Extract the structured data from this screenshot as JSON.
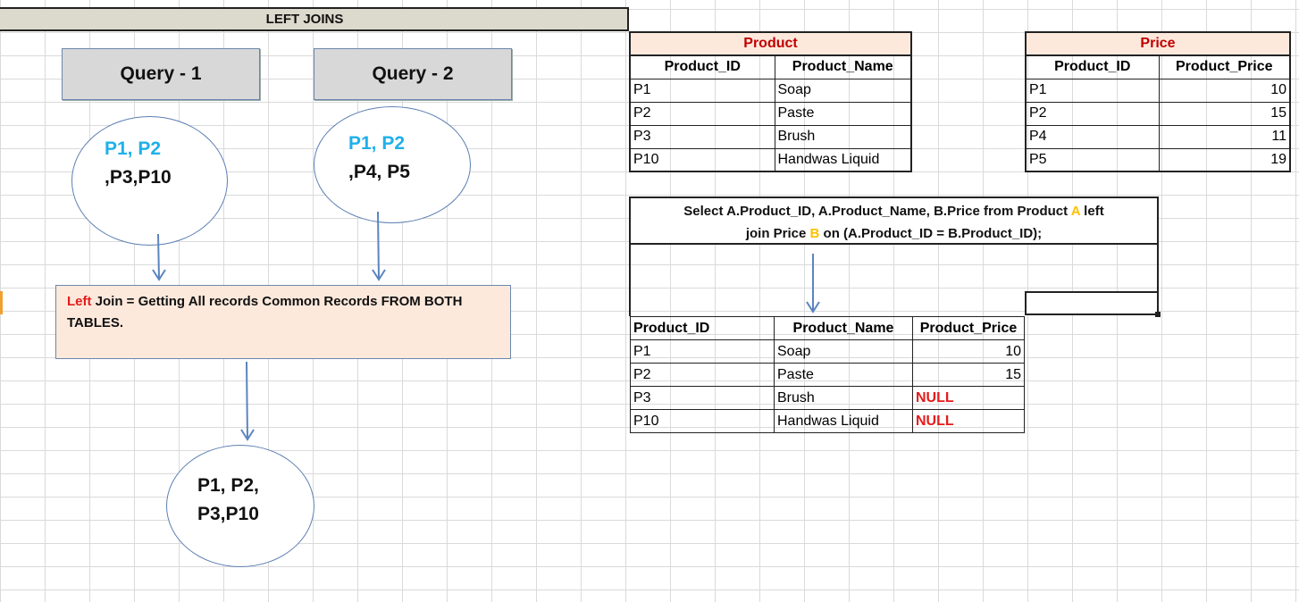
{
  "title": "LEFT JOINS",
  "queries": {
    "q1_label": "Query - 1",
    "q2_label": "Query - 2"
  },
  "ellipses": {
    "q1_line1": "P1, P2",
    "q1_line2": ",P3,P10",
    "q2_line1": "P1, P2",
    "q2_line2": ",P4, P5",
    "result_line1": "P1, P2,",
    "result_line2": "P3,P10"
  },
  "description": {
    "keyword": "Left",
    "text": " Join = Getting All records Common Records FROM BOTH TABLES."
  },
  "product_table": {
    "caption": "Product",
    "headers": [
      "Product_ID",
      "Product_Name"
    ],
    "rows": [
      [
        "P1",
        "Soap"
      ],
      [
        "P2",
        "Paste"
      ],
      [
        "P3",
        "Brush"
      ],
      [
        "P10",
        "Handwas Liquid"
      ]
    ]
  },
  "price_table": {
    "caption": "Price",
    "headers": [
      "Product_ID",
      "Product_Price"
    ],
    "rows": [
      [
        "P1",
        "10"
      ],
      [
        "P2",
        "15"
      ],
      [
        "P4",
        "11"
      ],
      [
        "P5",
        "19"
      ]
    ]
  },
  "sql": {
    "part1": "Select A.Product_ID, A.Product_Name, B.Price from Product ",
    "alias_a": "A",
    "part2": " left",
    "part3": "join Price ",
    "alias_b": "B",
    "part4": " on (A.Product_ID = B.Product_ID);"
  },
  "result_table": {
    "headers": [
      "Product_ID",
      "Product_Name",
      "Product_Price"
    ],
    "rows": [
      [
        "P1",
        "Soap",
        "10"
      ],
      [
        "P2",
        "Paste",
        "15"
      ],
      [
        "P3",
        "Brush",
        "NULL"
      ],
      [
        "P10",
        "Handwas Liquid",
        "NULL"
      ]
    ]
  },
  "colors": {
    "accent_cyan": "#1fb0ea",
    "null_red": "#e51b1b",
    "alias_orange": "#ffc000",
    "caption_red": "#c00000",
    "peach_fill": "#fde9dc",
    "arrow_blue": "#5b84c0"
  }
}
